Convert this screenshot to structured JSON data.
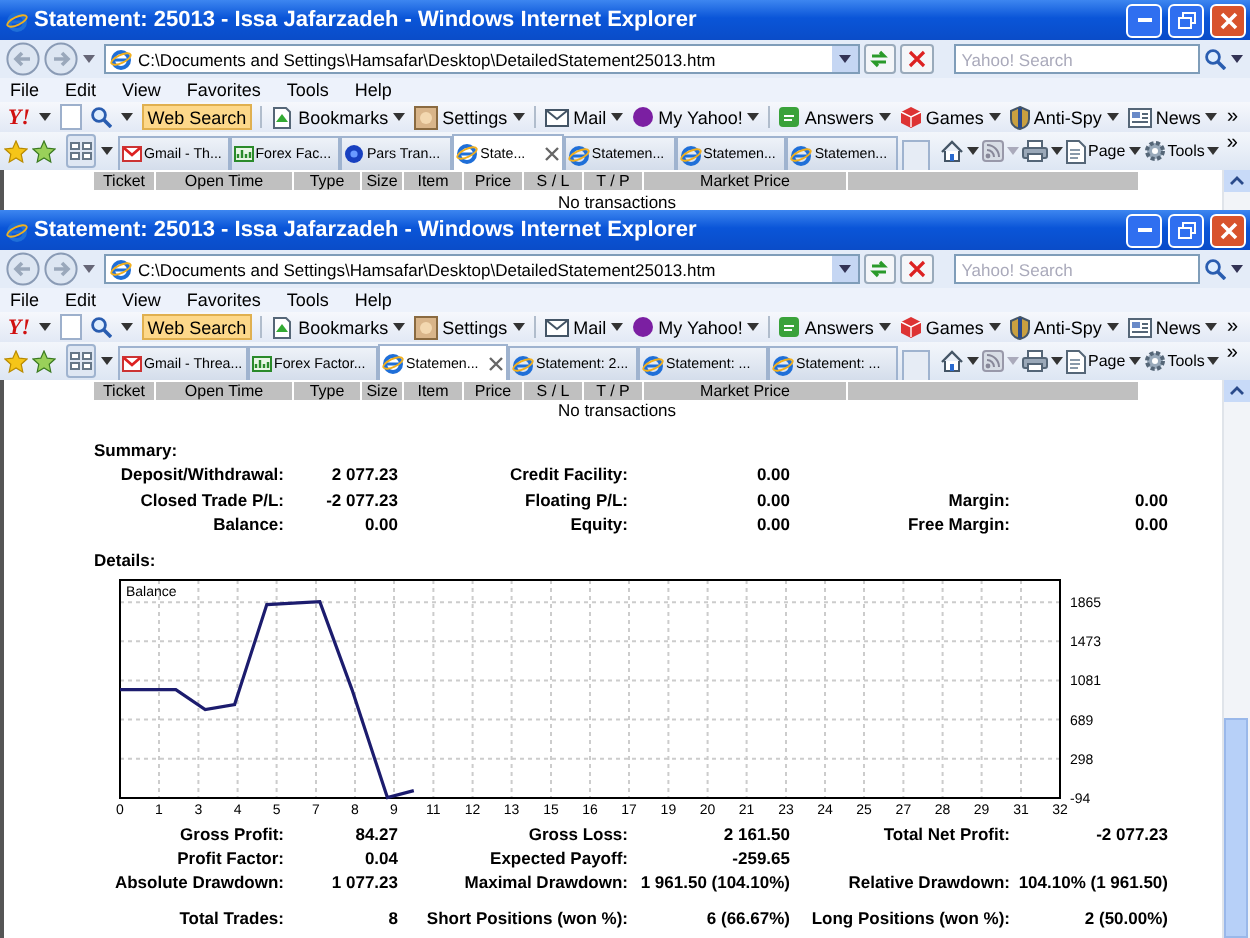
{
  "windows": [
    {
      "title": "Statement: 25013 - Issa Jafarzadeh - Windows Internet Explorer",
      "address": "C:\\Documents and Settings\\Hamsafar\\Desktop\\DetailedStatement25013.htm",
      "search": {
        "placeholder": "Yahoo! Search"
      },
      "menu": [
        "File",
        "Edit",
        "View",
        "Favorites",
        "Tools",
        "Help"
      ],
      "yahoo_toolbar": {
        "logo": "Y!",
        "search_button": "Web Search",
        "more": "»",
        "items": [
          {
            "label": "Bookmarks",
            "kind": "bookmarks"
          },
          {
            "label": "Settings",
            "kind": "settings"
          },
          {
            "label": "Mail",
            "kind": "mail"
          },
          {
            "label": "My Yahoo!",
            "kind": "myyahoo"
          },
          {
            "label": "Answers",
            "kind": "answers"
          },
          {
            "label": "Games",
            "kind": "games"
          },
          {
            "label": "Anti-Spy",
            "kind": "antispy"
          },
          {
            "label": "News",
            "kind": "news"
          }
        ]
      },
      "tabs": [
        {
          "label": "Gmail - Th...",
          "kind": "gmail",
          "selected": false
        },
        {
          "label": "Forex Fac...",
          "kind": "forex",
          "selected": false
        },
        {
          "label": "Pars Tran...",
          "kind": "pars",
          "selected": false
        },
        {
          "label": "State...",
          "kind": "ie",
          "selected": true
        },
        {
          "label": "Statemen...",
          "kind": "ie",
          "selected": false
        },
        {
          "label": "Statemen...",
          "kind": "ie",
          "selected": false
        },
        {
          "label": "Statemen...",
          "kind": "ie",
          "selected": false
        }
      ],
      "command_bar": {
        "page": "Page",
        "tools": "Tools",
        "more": "»"
      },
      "table_columns": [
        "Ticket",
        "Open Time",
        "Type",
        "Size",
        "Item",
        "Price",
        "S / L",
        "T / P",
        "Market Price"
      ],
      "empty_message": "No transactions"
    },
    {
      "title": "Statement: 25013 - Issa Jafarzadeh - Windows Internet Explorer",
      "address": "C:\\Documents and Settings\\Hamsafar\\Desktop\\DetailedStatement25013.htm",
      "search": {
        "placeholder": "Yahoo! Search"
      },
      "menu": [
        "File",
        "Edit",
        "View",
        "Favorites",
        "Tools",
        "Help"
      ],
      "yahoo_toolbar": {
        "logo": "Y!",
        "search_button": "Web Search",
        "more": "»",
        "items": [
          {
            "label": "Bookmarks",
            "kind": "bookmarks"
          },
          {
            "label": "Settings",
            "kind": "settings"
          },
          {
            "label": "Mail",
            "kind": "mail"
          },
          {
            "label": "My Yahoo!",
            "kind": "myyahoo"
          },
          {
            "label": "Answers",
            "kind": "answers"
          },
          {
            "label": "Games",
            "kind": "games"
          },
          {
            "label": "Anti-Spy",
            "kind": "antispy"
          },
          {
            "label": "News",
            "kind": "news"
          }
        ]
      },
      "tabs": [
        {
          "label": "Gmail - Threa...",
          "kind": "gmail",
          "selected": false
        },
        {
          "label": "Forex Factor...",
          "kind": "forex",
          "selected": false
        },
        {
          "label": "Statemen...",
          "kind": "ie",
          "selected": true
        },
        {
          "label": "Statement: 2...",
          "kind": "ie",
          "selected": false
        },
        {
          "label": "Statement: ...",
          "kind": "ie",
          "selected": false
        },
        {
          "label": "Statement: ...",
          "kind": "ie",
          "selected": false
        }
      ],
      "command_bar": {
        "page": "Page",
        "tools": "Tools",
        "more": "»"
      },
      "table_columns": [
        "Ticket",
        "Open Time",
        "Type",
        "Size",
        "Item",
        "Price",
        "S / L",
        "T / P",
        "Market Price"
      ],
      "empty_message": "No transactions",
      "summary": {
        "title": "Summary:",
        "rows": [
          {
            "pairs": [
              {
                "label": "Deposit/Withdrawal:",
                "value": "2 077.23"
              },
              {
                "label": "Credit Facility:",
                "value": "0.00"
              }
            ]
          },
          {
            "pairs": [
              {
                "label": "Closed Trade P/L:",
                "value": "-2 077.23"
              },
              {
                "label": "Floating P/L:",
                "value": "0.00"
              },
              {
                "label": "Margin:",
                "value": "0.00"
              }
            ]
          },
          {
            "pairs": [
              {
                "label": "Balance:",
                "value": "0.00"
              },
              {
                "label": "Equity:",
                "value": "0.00"
              },
              {
                "label": "Free Margin:",
                "value": "0.00"
              }
            ]
          }
        ]
      },
      "details": {
        "title": "Details:",
        "chart_data": {
          "type": "line",
          "grid": true,
          "x": [
            0,
            1.9,
            2.9,
            3.9,
            5,
            6.8,
            7.9,
            9.1,
            10
          ],
          "series": [
            {
              "name": "Balance",
              "color": "#1c1c6e",
              "values": [
                990,
                990,
                790,
                840,
                1840,
                1870,
                990,
                -90,
                -20
              ]
            }
          ],
          "xlim": [
            0,
            32
          ],
          "ylim": [
            -94,
            2086
          ],
          "xticks": [
            0,
            {
              "value": 1.33,
              "label": "1"
            },
            {
              "value": 2.67,
              "label": "3"
            },
            4,
            {
              "value": 5.33,
              "label": "5"
            },
            {
              "value": 6.67,
              "label": "7"
            },
            8,
            {
              "value": 9.33,
              "label": "9"
            },
            {
              "value": 10.67,
              "label": "11"
            },
            12,
            {
              "value": 13.33,
              "label": "13"
            },
            {
              "value": 14.67,
              "label": "15"
            },
            16,
            {
              "value": 17.33,
              "label": "17"
            },
            {
              "value": 18.67,
              "label": "19"
            },
            20,
            {
              "value": 21.33,
              "label": "21"
            },
            {
              "value": 22.67,
              "label": "23"
            },
            24,
            {
              "value": 25.33,
              "label": "25"
            },
            {
              "value": 26.67,
              "label": "27"
            },
            28,
            {
              "value": 29.33,
              "label": "29"
            },
            {
              "value": 30.67,
              "label": "31"
            },
            32
          ],
          "yticks": [
            -94,
            298,
            689,
            1081,
            1473,
            1865
          ]
        },
        "stat_groups": [
          [
            {
              "pairs": [
                {
                  "label": "Gross Profit:",
                  "value": "84.27"
                },
                {
                  "label": "Gross Loss:",
                  "value": "2 161.50"
                },
                {
                  "label": "Total Net Profit:",
                  "value": "-2 077.23"
                }
              ]
            },
            {
              "pairs": [
                {
                  "label": "Profit Factor:",
                  "value": "0.04"
                },
                {
                  "label": "Expected Payoff:",
                  "value": "-259.65"
                }
              ]
            },
            {
              "pairs": [
                {
                  "label": "Absolute Drawdown:",
                  "value": "1 077.23"
                },
                {
                  "label": "Maximal Drawdown:",
                  "value": "1 961.50 (104.10%)"
                },
                {
                  "label": "Relative Drawdown:",
                  "value": "104.10% (1 961.50)"
                }
              ]
            }
          ],
          [
            {
              "pairs": [
                {
                  "label": "Total Trades:",
                  "value": "8"
                },
                {
                  "label": "Short Positions (won %):",
                  "value": "6 (66.67%)"
                },
                {
                  "label": "Long Positions (won %):",
                  "value": "2 (50.00%)"
                }
              ]
            }
          ]
        ]
      }
    }
  ]
}
